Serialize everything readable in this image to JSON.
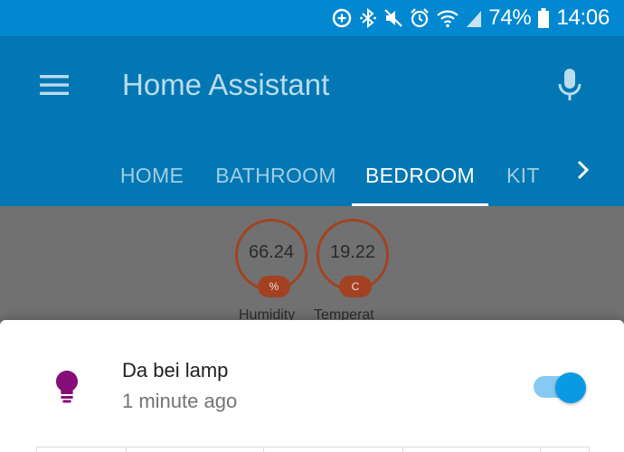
{
  "status_bar": {
    "battery_percent": "74%",
    "time": "14:06",
    "icons": [
      "data-saver-icon",
      "bluetooth-icon",
      "mute-icon",
      "alarm-icon",
      "wifi-icon",
      "signal-icon",
      "battery-icon"
    ]
  },
  "app_bar": {
    "title": "Home Assistant",
    "menu_icon": "menu-icon",
    "mic_icon": "microphone-icon"
  },
  "tabs": [
    {
      "label": "HOME",
      "active": false
    },
    {
      "label": "BATHROOM",
      "active": false
    },
    {
      "label": "BEDROOM",
      "active": true
    },
    {
      "label": "KIT",
      "active": false
    }
  ],
  "badges": [
    {
      "value": "66.24",
      "unit": "%",
      "label": "Humidity"
    },
    {
      "value": "19.22",
      "unit": "C",
      "label": "Temperat"
    }
  ],
  "dialog": {
    "entity_name": "Da bei lamp",
    "last_changed": "1 minute ago",
    "icon": "lightbulb-icon",
    "toggle_on": true
  },
  "colors": {
    "status_bar": "#0288d1",
    "app_bar": "#0277b3",
    "badge_accent": "#a34222",
    "bulb": "#870e78",
    "toggle": "#0a9ae3"
  }
}
